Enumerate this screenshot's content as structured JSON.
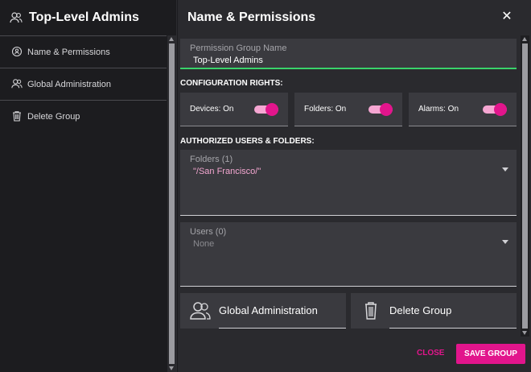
{
  "sidebar": {
    "title": "Top-Level Admins",
    "header_icon": "group-icon",
    "items": [
      {
        "label": "Name & Permissions",
        "icon": "badge-icon"
      },
      {
        "label": "Global Administration",
        "icon": "group-icon"
      },
      {
        "label": "Delete Group",
        "icon": "trash-icon"
      }
    ]
  },
  "panel": {
    "title": "Name & Permissions",
    "close_glyph": "✕"
  },
  "name_field": {
    "label": "Permission Group Name",
    "value": "Top-Level Admins"
  },
  "config": {
    "heading": "CONFIGURATION RIGHTS:",
    "toggles": [
      {
        "label": "Devices: On",
        "on": true
      },
      {
        "label": "Folders: On",
        "on": true
      },
      {
        "label": "Alarms: On",
        "on": true
      }
    ]
  },
  "authorized": {
    "heading": "AUTHORIZED USERS & FOLDERS:",
    "folders": {
      "label": "Folders (1)",
      "value": "\"/San Francisco/\""
    },
    "users": {
      "label": "Users (0)",
      "value": "None"
    }
  },
  "actions": {
    "global_admin_label": "Global Administration",
    "delete_group_label": "Delete Group"
  },
  "footer": {
    "close_label": "CLOSE",
    "save_label": "SAVE GROUP"
  },
  "colors": {
    "accent": "#e2158c",
    "focus_underline": "#39d36a",
    "background": "#1c1c1f",
    "panel": "#2a2a2e"
  }
}
